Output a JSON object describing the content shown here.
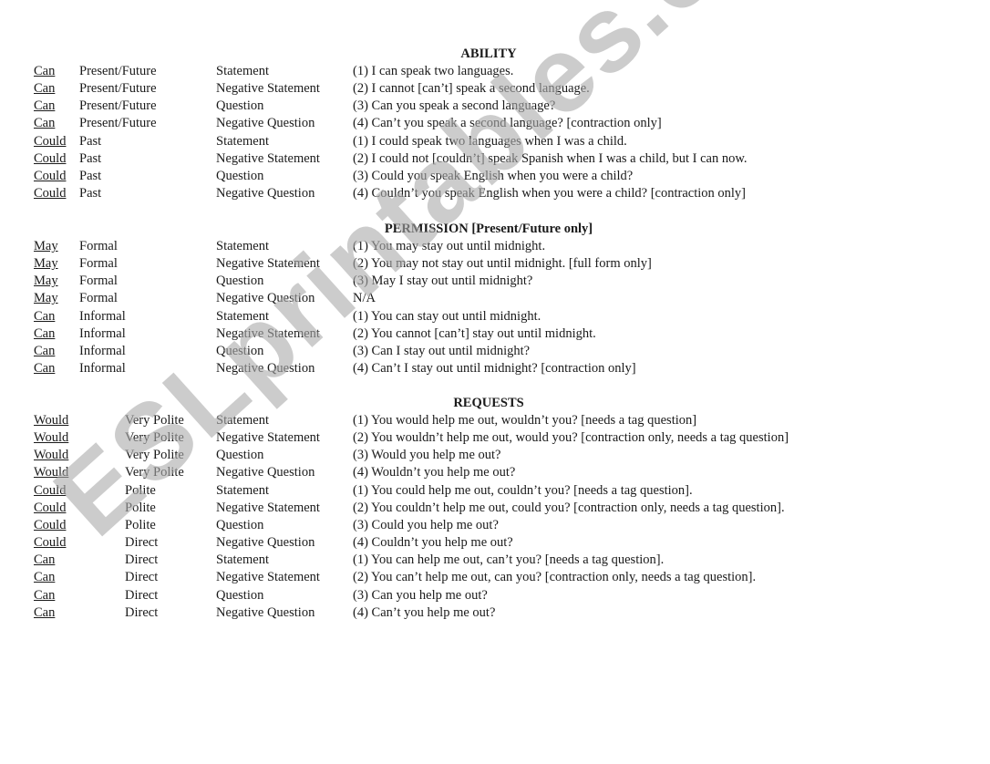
{
  "watermark": "ESLprintables.com",
  "sections": [
    {
      "title": "ABILITY",
      "rows": [
        {
          "modal": "Can",
          "usage": "Present/Future",
          "type": "Statement",
          "example": "(1) I can speak two languages."
        },
        {
          "modal": "Can",
          "usage": "Present/Future",
          "type": "Negative Statement",
          "example": "(2) I cannot [can’t] speak a second language."
        },
        {
          "modal": "Can",
          "usage": "Present/Future",
          "type": "Question",
          "example": "(3) Can you speak a second language?"
        },
        {
          "modal": "Can",
          "usage": "Present/Future",
          "type": "Negative Question",
          "example": "(4) Can’t you speak a second language? [contraction only]"
        },
        {
          "modal": "Could",
          "usage": "Past",
          "type": "Statement",
          "example": "(1) I could speak two languages when I was a child."
        },
        {
          "modal": "Could",
          "usage": "Past",
          "type": "Negative Statement",
          "example": "(2) I could not [couldn’t] speak Spanish when I was a child, but I can now."
        },
        {
          "modal": "Could",
          "usage": "Past",
          "type": "Question",
          "example": "(3) Could you speak English when you were a child?"
        },
        {
          "modal": "Could",
          "usage": "Past",
          "type": "Negative Question",
          "example": "(4) Couldn’t you speak English when you were a child? [contraction only]"
        }
      ]
    },
    {
      "title": "PERMISSION [Present/Future only]",
      "rows": [
        {
          "modal": "May",
          "usage": "Formal",
          "type": "Statement",
          "example": "(1) You may stay out until midnight."
        },
        {
          "modal": "May",
          "usage": "Formal",
          "type": "Negative Statement",
          "example": "(2) You may not stay out until midnight. [full form only]"
        },
        {
          "modal": "May",
          "usage": "Formal",
          "type": "Question",
          "example": "(3) May I stay out until midnight?"
        },
        {
          "modal": "May",
          "usage": "Formal",
          "type": "Negative Question",
          "example": "N/A"
        },
        {
          "modal": "Can",
          "usage": "Informal",
          "type": "Statement",
          "example": "(1) You can stay out until midnight."
        },
        {
          "modal": "Can",
          "usage": "Informal",
          "type": "Negative Statement",
          "example": "(2) You cannot [can’t] stay out until midnight."
        },
        {
          "modal": "Can",
          "usage": "Informal",
          "type": "Question",
          "example": "(3) Can I stay out until midnight?"
        },
        {
          "modal": "Can",
          "usage": "Informal",
          "type": "Negative Question",
          "example": "(4) Can’t I stay out until midnight? [contraction only]"
        }
      ]
    },
    {
      "title": "REQUESTS",
      "rows": [
        {
          "modal": "Would",
          "usage": "Very Polite",
          "type": "Statement",
          "example": "(1) You would help me out, wouldn’t you? [needs a tag question]"
        },
        {
          "modal": "Would",
          "usage": "Very Polite",
          "type": "Negative Statement",
          "example": "(2) You wouldn’t help me out, would you? [contraction only, needs a tag question]"
        },
        {
          "modal": "Would",
          "usage": "Very Polite",
          "type": "Question",
          "example": "(3) Would you help me out?"
        },
        {
          "modal": "Would",
          "usage": "Very Polite",
          "type": "Negative Question",
          "example": "(4) Wouldn’t you help me out?"
        },
        {
          "modal": "Could",
          "usage": "Polite",
          "type": "Statement",
          "example": "(1) You could help me out, couldn’t you? [needs a tag question]."
        },
        {
          "modal": "Could",
          "usage": "Polite",
          "type": "Negative Statement",
          "example": "(2) You couldn’t help me out, could you? [contraction only, needs a tag question]."
        },
        {
          "modal": "Could",
          "usage": "Polite",
          "type": "Question",
          "example": "(3) Could you help me out?"
        },
        {
          "modal": "Could",
          "usage": "Direct",
          "type": "Negative Question",
          "example": "(4) Couldn’t you help me out?"
        },
        {
          "modal": "Can",
          "usage": "Direct",
          "type": "Statement",
          "example": "(1) You can help me out, can’t you? [needs a tag question]."
        },
        {
          "modal": "Can",
          "usage": "Direct",
          "type": "Negative Statement",
          "example": "(2) You can’t help me out, can you? [contraction only, needs a tag question]."
        },
        {
          "modal": "Can",
          "usage": "Direct",
          "type": "Question",
          "example": "(3) Can you help me out?"
        },
        {
          "modal": "Can",
          "usage": "Direct",
          "type": "Negative Question",
          "example": "(4) Can’t you help me out?"
        }
      ]
    }
  ]
}
